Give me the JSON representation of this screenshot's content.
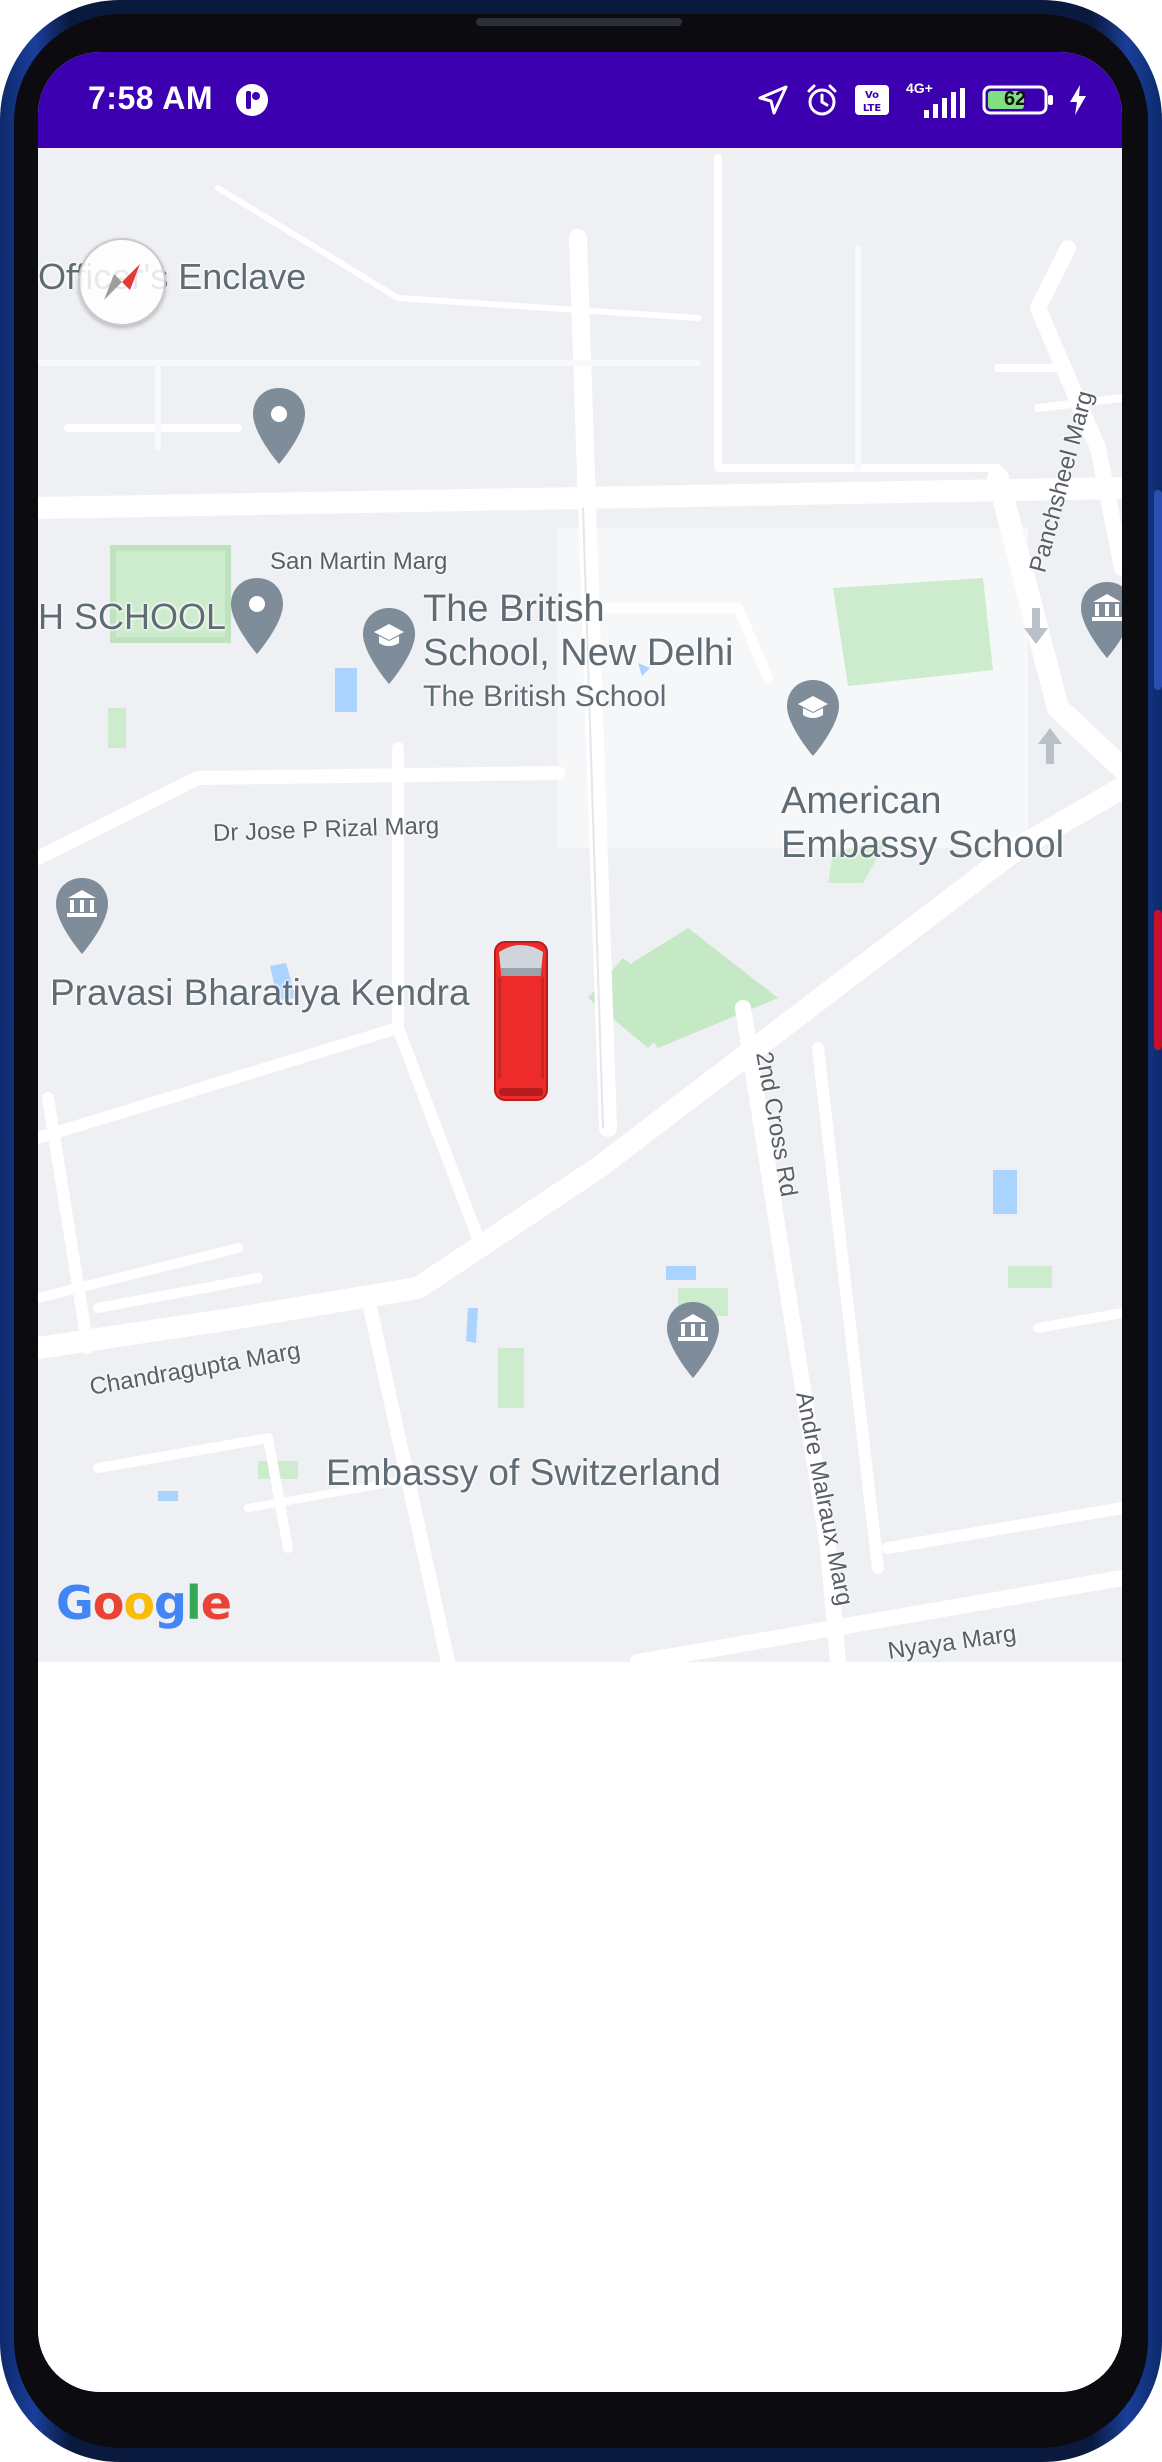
{
  "status_bar": {
    "time": "7:58 AM",
    "network": "4G+",
    "battery_level": "62",
    "colors": {
      "background": "#3c00b0"
    }
  },
  "map": {
    "labels": {
      "officers_enclave": "Officer's Enclave",
      "h_school": "H SCHOOL",
      "british_school_line1": "The British",
      "british_school_line2": "School, New Delhi",
      "british_school_sub": "The British School",
      "american_school_line1": "American",
      "american_school_line2": "Embassy School",
      "pravasi": "Pravasi Bharatiya Kendra",
      "switzerland": "Embassy of Switzerland"
    },
    "roads": {
      "san_martin": "San Martin Marg",
      "panchsheel": "Panchsheel Marg",
      "rizal": "Dr Jose P Rizal Marg",
      "cross2": "2nd Cross Rd",
      "chandragupta": "Chandragupta Marg",
      "malraux": "Andre Malraux Marg",
      "nyaya": "Nyaya Marg"
    },
    "attribution": {
      "g1": "G",
      "o1": "o",
      "o2": "o",
      "g2": "g",
      "l": "l",
      "e": "e"
    },
    "icons": [
      "compass-icon",
      "location-pin-icon",
      "school-pin-icon",
      "museum-pin-icon",
      "vehicle-marker-icon"
    ],
    "colors": {
      "land": "#eef0f3",
      "road": "#ffffff",
      "park": "#cdeccd",
      "water": "#aad4ff",
      "pin": "#7f8c99",
      "vehicle": "#ee2b2b"
    }
  }
}
